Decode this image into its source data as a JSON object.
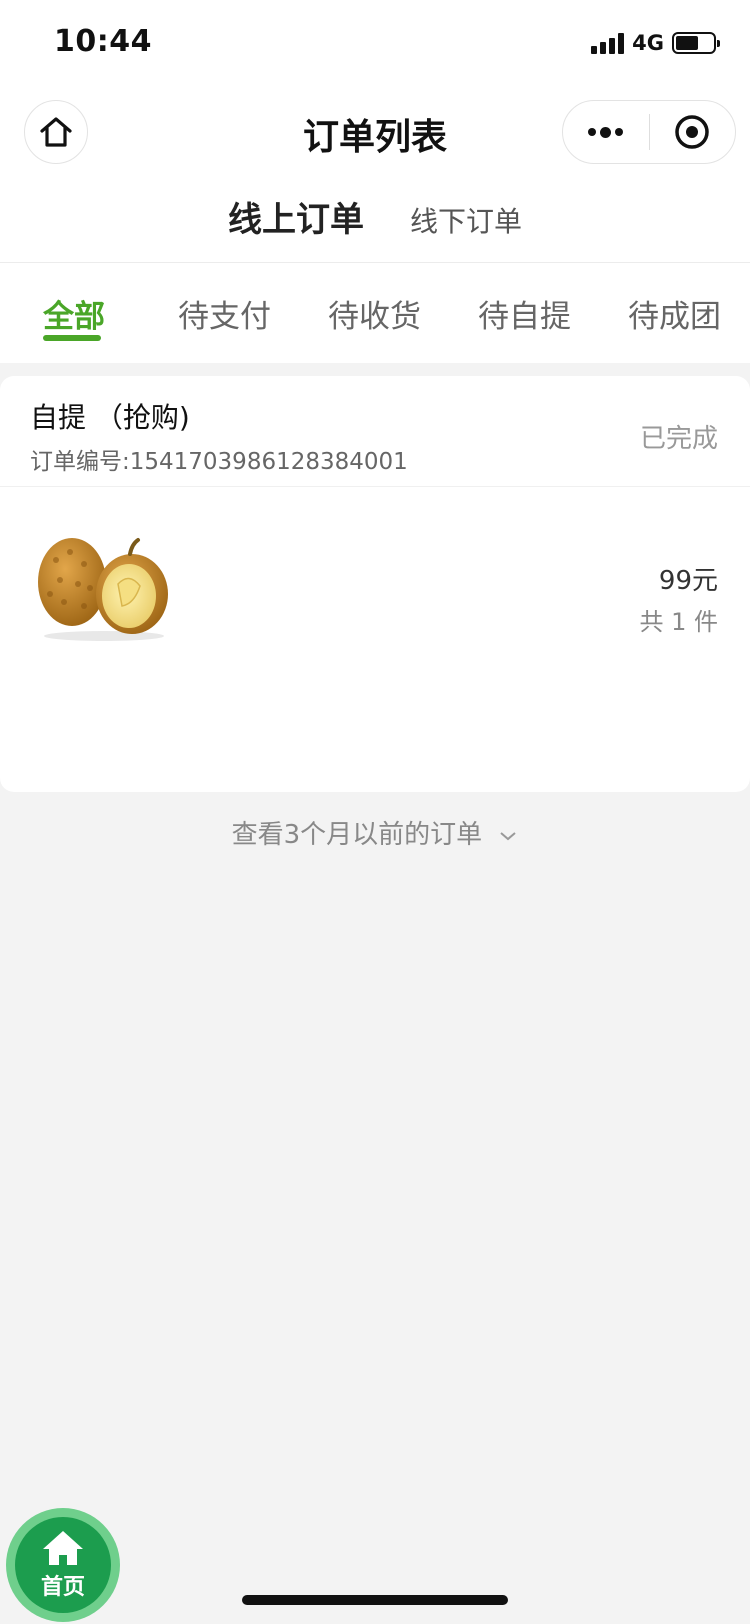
{
  "status_bar": {
    "time": "10:44",
    "network": "4G",
    "battery_level": 0.6
  },
  "nav": {
    "title": "订单列表"
  },
  "source_tabs": {
    "active": "线上订单",
    "other": "线下订单"
  },
  "status_tabs": [
    {
      "label": "全部",
      "active": true
    },
    {
      "label": "待支付",
      "active": false
    },
    {
      "label": "待收货",
      "active": false
    },
    {
      "label": "待自提",
      "active": false
    },
    {
      "label": "待成团",
      "active": false
    }
  ],
  "order": {
    "type": "自提 （抢购)",
    "number": "订单编号:1541703986128384001",
    "status": "已完成",
    "product_image": "durian",
    "price": "99元",
    "quantity": "共 1 件"
  },
  "older_orders_link": "查看3个月以前的订单",
  "float_home": {
    "label": "首页"
  },
  "colors": {
    "accent": "#4aa628",
    "float_button": "#1c9d4e",
    "background": "#f3f3f3"
  }
}
